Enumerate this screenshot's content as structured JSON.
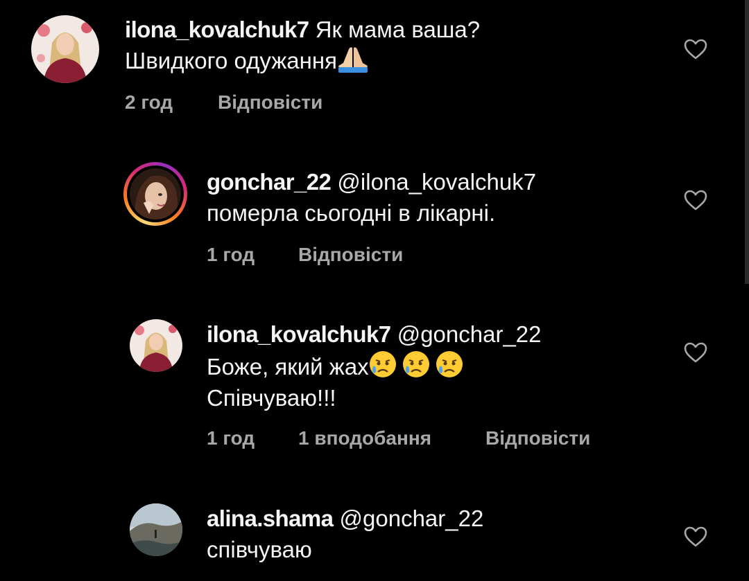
{
  "comments": [
    {
      "username": "ilona_kovalchuk7",
      "mention": "",
      "text_line1": "Як мама ваша?",
      "text_line2": "Швидкого одужання",
      "emoji": "folded-hands",
      "time": "2 год",
      "likes": "",
      "reply": "Відповісти"
    },
    {
      "username": "gonchar_22",
      "mention": "@ilona_kovalchuk7",
      "text_line1": "померла сьогодні в лікарні.",
      "time": "1 год",
      "likes": "",
      "reply": "Відповісти"
    },
    {
      "username": "ilona_kovalchuk7",
      "mention": "@gonchar_22",
      "text_line1": "Боже, який жах",
      "text_line2": "Співчуваю!!!",
      "emoji": "crying-face",
      "time": "1 год",
      "likes": "1 вподобання",
      "reply": "Відповісти"
    },
    {
      "username": "alina.shama",
      "mention": "@gonchar_22",
      "text_line1": "співчуваю"
    }
  ],
  "icons": {
    "like": "heart-outline-icon",
    "story_ring": "story-ring"
  },
  "colors": {
    "background": "#000000",
    "text": "#f5f5f5",
    "meta": "#a8a8a8"
  }
}
